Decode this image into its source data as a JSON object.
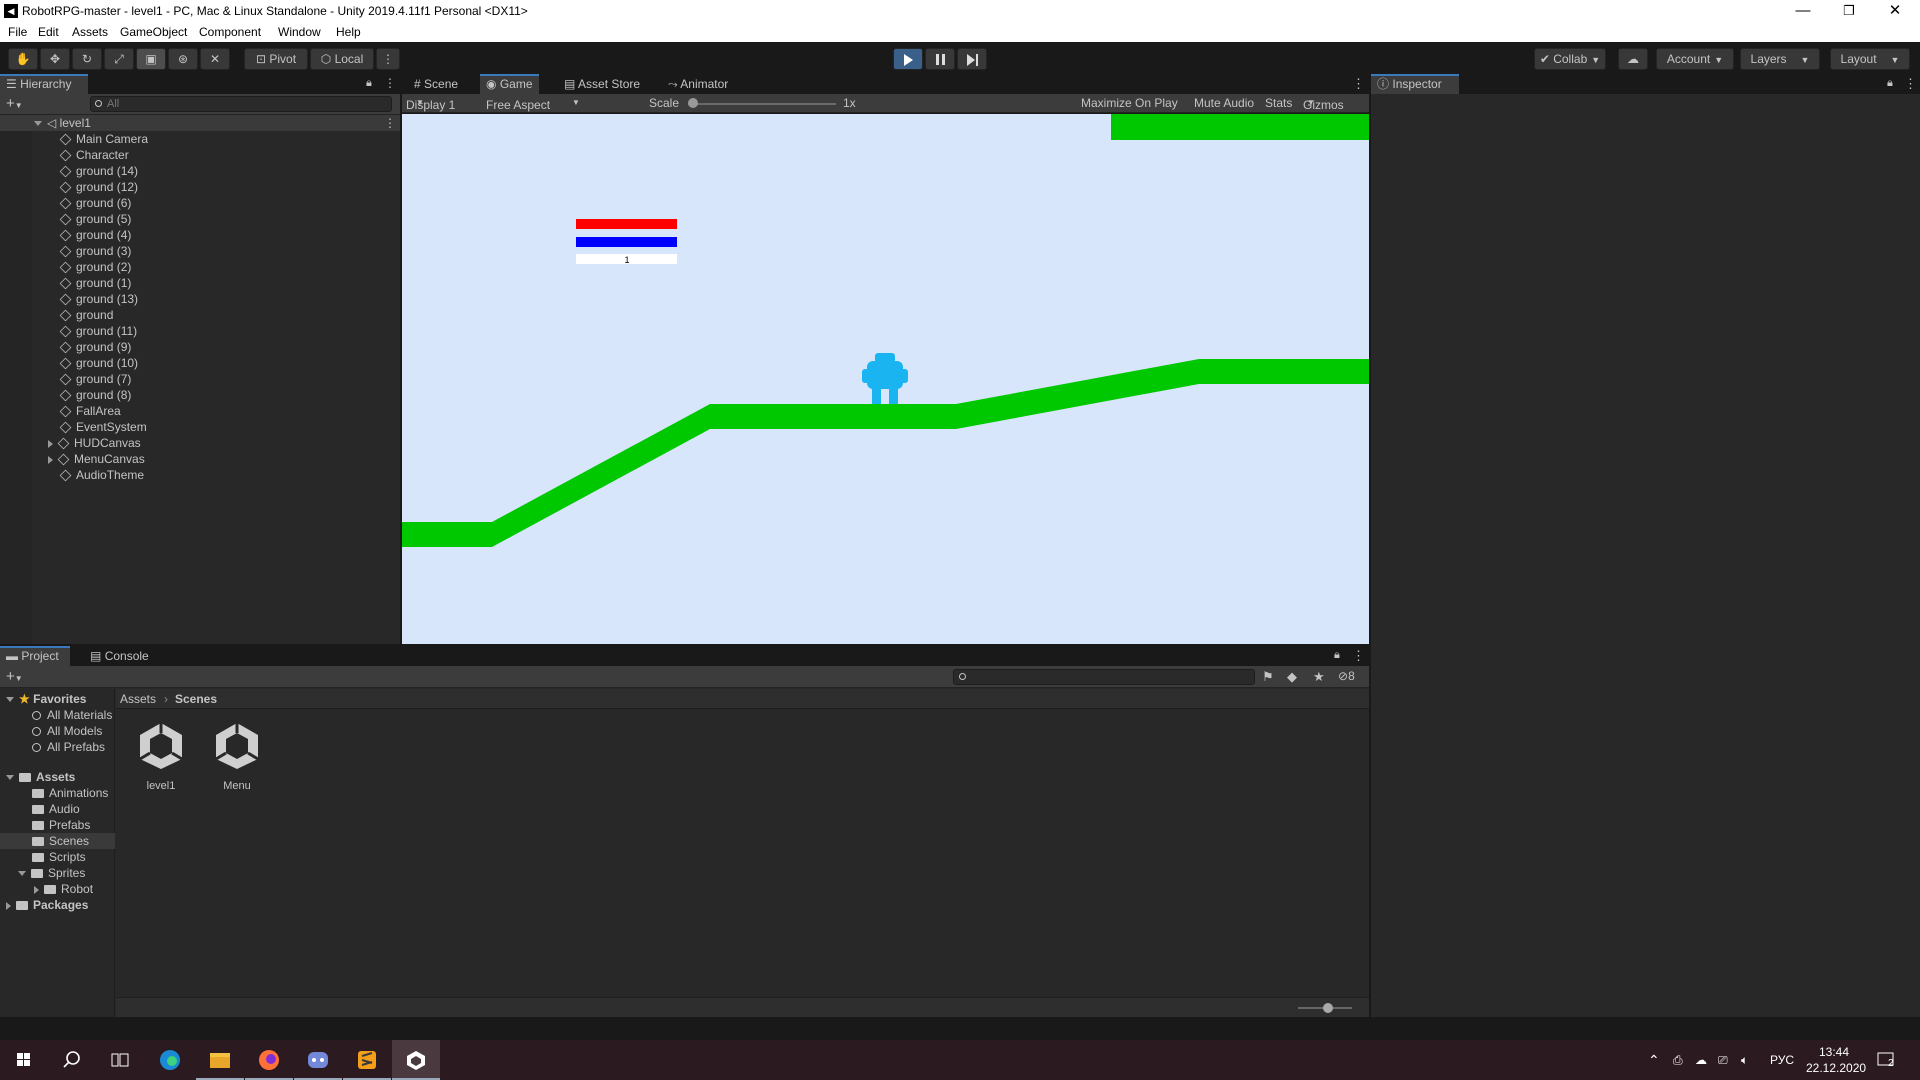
{
  "window": {
    "title": "RobotRPG-master - level1 - PC, Mac & Linux Standalone - Unity 2019.4.11f1 Personal <DX11>",
    "logo": "unity-logo"
  },
  "menu": [
    "File",
    "Edit",
    "Assets",
    "GameObject",
    "Component",
    "Window",
    "Help"
  ],
  "toolbar": {
    "pivot": "Pivot",
    "local": "Local",
    "collab": "Collab",
    "account": "Account",
    "layers": "Layers",
    "layout": "Layout"
  },
  "hierarchy": {
    "tab": "Hierarchy",
    "search_placeholder": "All",
    "scene": "level1",
    "items": [
      {
        "label": "Main Camera",
        "expandable": false
      },
      {
        "label": "Character",
        "expandable": false
      },
      {
        "label": "ground (14)",
        "expandable": false
      },
      {
        "label": "ground (12)",
        "expandable": false
      },
      {
        "label": "ground (6)",
        "expandable": false
      },
      {
        "label": "ground (5)",
        "expandable": false
      },
      {
        "label": "ground (4)",
        "expandable": false
      },
      {
        "label": "ground (3)",
        "expandable": false
      },
      {
        "label": "ground (2)",
        "expandable": false
      },
      {
        "label": "ground (1)",
        "expandable": false
      },
      {
        "label": "ground (13)",
        "expandable": false
      },
      {
        "label": "ground",
        "expandable": false
      },
      {
        "label": "ground (11)",
        "expandable": false
      },
      {
        "label": "ground (9)",
        "expandable": false
      },
      {
        "label": "ground (10)",
        "expandable": false
      },
      {
        "label": "ground (7)",
        "expandable": false
      },
      {
        "label": "ground (8)",
        "expandable": false
      },
      {
        "label": "FallArea",
        "expandable": false
      },
      {
        "label": "EventSystem",
        "expandable": false
      },
      {
        "label": "HUDCanvas",
        "expandable": true
      },
      {
        "label": "MenuCanvas",
        "expandable": true
      },
      {
        "label": "AudioTheme",
        "expandable": false
      }
    ]
  },
  "center_tabs": [
    "Scene",
    "Game",
    "Asset Store",
    "Animator"
  ],
  "gamebar": {
    "display": "Display 1",
    "aspect": "Free Aspect",
    "scale_label": "Scale",
    "scale_value": "1x",
    "maximize": "Maximize On Play",
    "mute": "Mute Audio",
    "stats": "Stats",
    "gizmos": "Gizmos"
  },
  "game": {
    "background": "#d8e6fb",
    "ground_color": "#00c800",
    "character_color": "#1ab4f0",
    "health_bar_color": "#ff0000",
    "mana_bar_color": "#0000ff",
    "level_text": "1"
  },
  "inspector": {
    "tab": "Inspector"
  },
  "bottom_tabs": [
    "Project",
    "Console"
  ],
  "project": {
    "hidden_count": "8",
    "favorites": {
      "label": "Favorites",
      "items": [
        "All Materials",
        "All Models",
        "All Prefabs"
      ]
    },
    "assets": {
      "label": "Assets",
      "items": [
        "Animations",
        "Audio",
        "Prefabs",
        "Scenes",
        "Scripts",
        "Sprites"
      ],
      "sprites_child": "Robot"
    },
    "packages": "Packages",
    "breadcrumb": [
      "Assets",
      "Scenes"
    ],
    "files": [
      "level1",
      "Menu"
    ]
  },
  "taskbar": {
    "lang": "РУС",
    "time": "13:44",
    "date": "22.12.2020",
    "notification_count": "2"
  }
}
